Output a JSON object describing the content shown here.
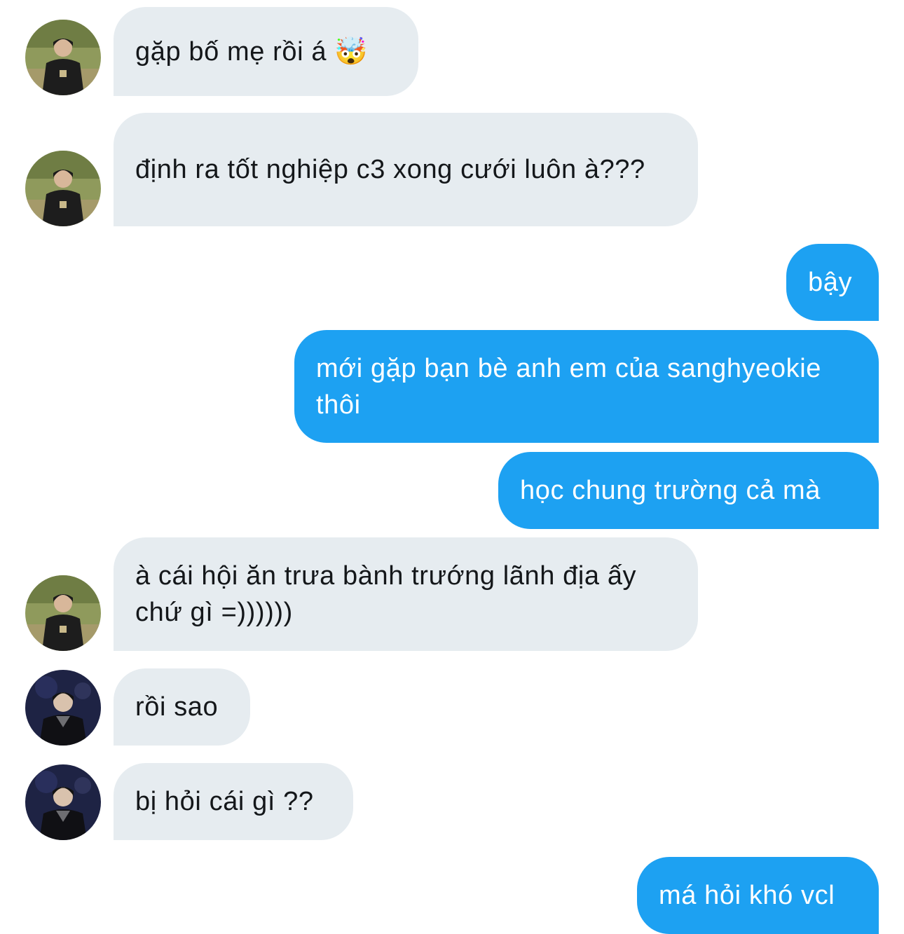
{
  "conversation": {
    "messages": [
      {
        "from": "other-1",
        "text": "gặp bố mẹ rồi á 🤯"
      },
      {
        "from": "other-1",
        "text": "định ra tốt nghiệp c3 xong cưới luôn à???"
      },
      {
        "from": "me",
        "text": "bậy"
      },
      {
        "from": "me",
        "text": "mới gặp bạn bè anh em của sanghyeokie thôi"
      },
      {
        "from": "me",
        "text": "học chung trường cả mà"
      },
      {
        "from": "other-1",
        "text": "à cái hội ăn trưa bành trướng lãnh địa ấy chứ gì =))))))"
      },
      {
        "from": "other-2",
        "text": "rồi sao"
      },
      {
        "from": "other-2",
        "text": "bị hỏi cái gì ??"
      },
      {
        "from": "me",
        "text": "má hỏi khó vcl"
      }
    ]
  },
  "colors": {
    "incoming_bubble": "#e6ecf0",
    "outgoing_bubble": "#1da1f2",
    "incoming_text": "#14171a",
    "outgoing_text": "#ffffff"
  }
}
